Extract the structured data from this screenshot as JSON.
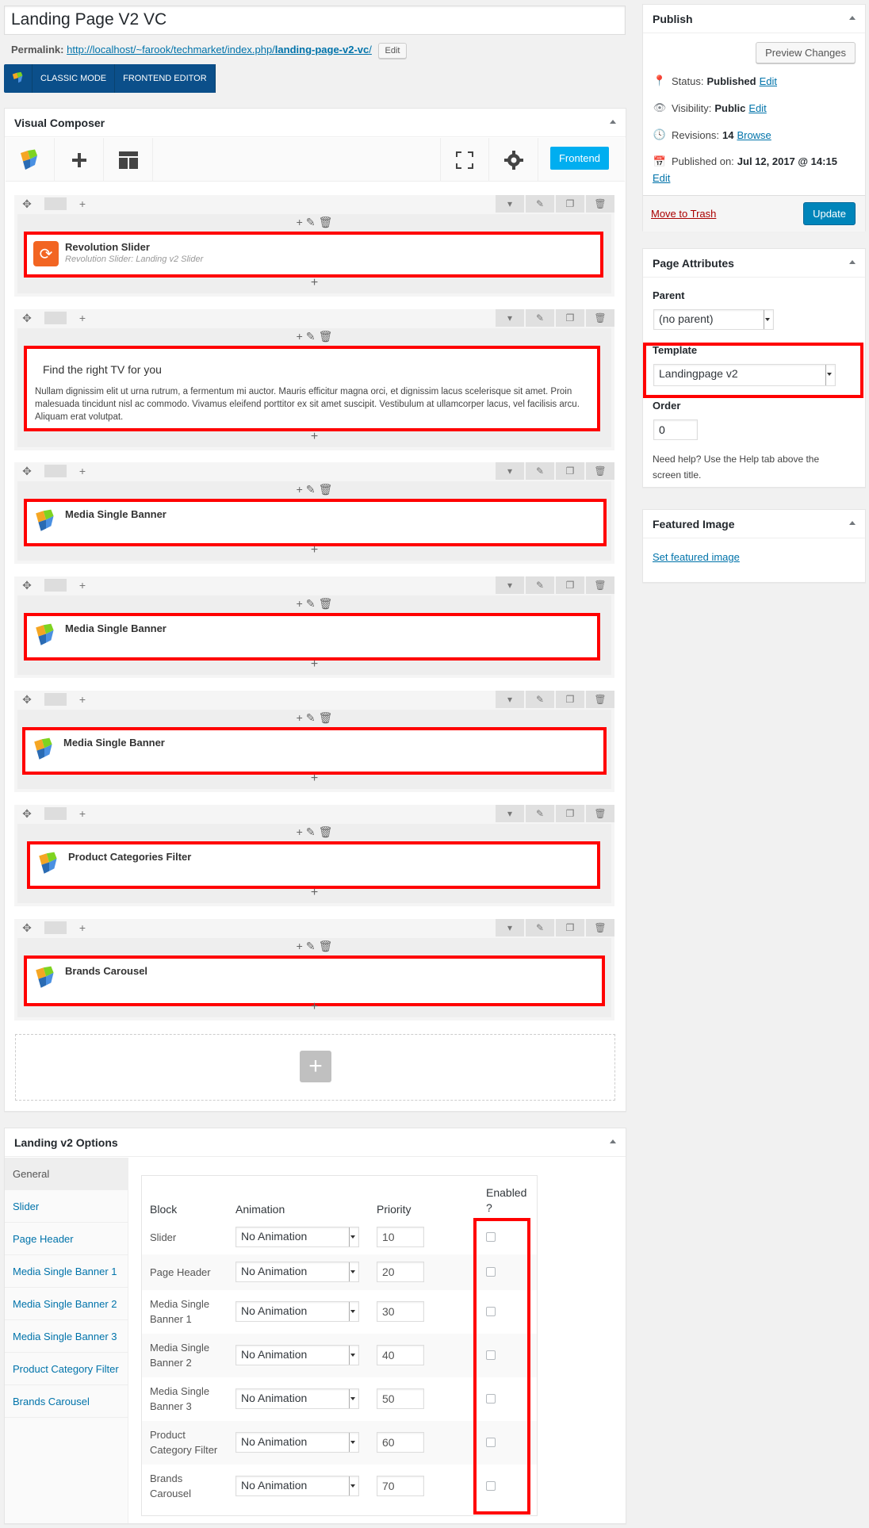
{
  "post_title": "Landing Page V2 VC",
  "permalink": {
    "label": "Permalink:",
    "base": "http://localhost/~farook/techmarket/index.php/",
    "slug": "landing-page-v2-vc",
    "tail": "/",
    "edit": "Edit"
  },
  "vc_modes": {
    "classic": "CLASSIC MODE",
    "frontend": "FRONTEND EDITOR"
  },
  "vc": {
    "title": "Visual Composer",
    "frontend_label": "Frontend",
    "rows": [
      {
        "name": "Revolution Slider",
        "sub": "Revolution Slider: Landing v2 Slider",
        "icon": "revolution-slider-icon"
      },
      {
        "heading": "Find the right TV for you",
        "text": "Nullam dignissim elit ut urna rutrum, a fermentum mi auctor. Mauris efficitur magna orci, et dignissim lacus scelerisque sit amet. Proin malesuada tincidunt nisl ac commodo. Vivamus eleifend porttitor ex sit amet suscipit. Vestibulum at ullamcorper lacus, vel facilisis arcu. Aliquam erat volutpat."
      },
      {
        "name": "Media Single Banner",
        "icon": "vc-logo-icon"
      },
      {
        "name": "Media Single Banner",
        "icon": "vc-logo-icon"
      },
      {
        "name": "Media Single Banner",
        "icon": "vc-logo-icon"
      },
      {
        "name": "Product Categories Filter",
        "icon": "vc-logo-icon"
      },
      {
        "name": "Brands Carousel",
        "icon": "vc-logo-icon"
      }
    ]
  },
  "publish": {
    "title": "Publish",
    "preview": "Preview Changes",
    "status_label": "Status:",
    "status_value": "Published",
    "status_edit": "Edit",
    "visibility_label": "Visibility:",
    "visibility_value": "Public",
    "visibility_edit": "Edit",
    "revisions_label": "Revisions:",
    "revisions_value": "14",
    "revisions_link": "Browse",
    "published_label": "Published on:",
    "published_value": "Jul 12, 2017 @ 14:15",
    "published_edit": "Edit",
    "trash": "Move to Trash",
    "update": "Update"
  },
  "page_attributes": {
    "title": "Page Attributes",
    "parent_label": "Parent",
    "parent_value": "(no parent)",
    "template_label": "Template",
    "template_value": "Landingpage v2",
    "order_label": "Order",
    "order_value": "0",
    "help": "Need help? Use the Help tab above the screen title."
  },
  "featured": {
    "title": "Featured Image",
    "link": "Set featured image"
  },
  "options": {
    "title": "Landing v2 Options",
    "nav": [
      "General",
      "Slider",
      "Page Header",
      "Media Single Banner 1",
      "Media Single Banner 2",
      "Media Single Banner 3",
      "Product Category Filter",
      "Brands Carousel"
    ],
    "headers": {
      "block": "Block",
      "animation": "Animation",
      "priority": "Priority",
      "enabled": "Enabled ?"
    },
    "rows": [
      {
        "block": "Slider",
        "animation": "No Animation",
        "priority": "10",
        "enabled": false
      },
      {
        "block": "Page Header",
        "animation": "No Animation",
        "priority": "20",
        "enabled": false
      },
      {
        "block": "Media Single Banner 1",
        "animation": "No Animation",
        "priority": "30",
        "enabled": false
      },
      {
        "block": "Media Single Banner 2",
        "animation": "No Animation",
        "priority": "40",
        "enabled": false
      },
      {
        "block": "Media Single Banner 3",
        "animation": "No Animation",
        "priority": "50",
        "enabled": false
      },
      {
        "block": "Product Category Filter",
        "animation": "No Animation",
        "priority": "60",
        "enabled": false
      },
      {
        "block": "Brands Carousel",
        "animation": "No Animation",
        "priority": "70",
        "enabled": false
      }
    ]
  },
  "colors": {
    "accent": "#0073aa",
    "highlight": "#ff0000",
    "vc_frontend": "#00aef0",
    "vc_bar": "#0b4f8a"
  }
}
